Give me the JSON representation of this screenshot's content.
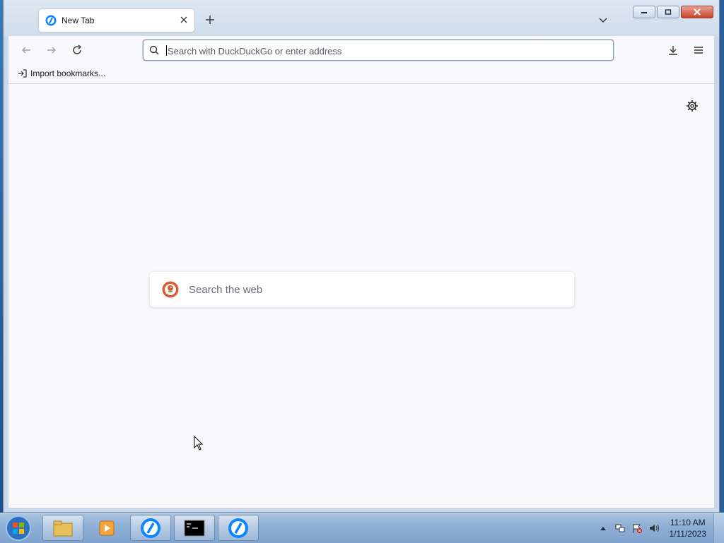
{
  "browser": {
    "tab": {
      "title": "New Tab"
    },
    "urlbar": {
      "placeholder": "Search with DuckDuckGo or enter address",
      "value": ""
    },
    "bookmarks_bar": {
      "import_label": "Import bookmarks..."
    },
    "new_tab": {
      "websearch_placeholder": "Search the web"
    }
  },
  "taskbar": {
    "items": [
      "file-explorer",
      "media-player",
      "firefox",
      "command-prompt",
      "firefox"
    ],
    "clock": {
      "time": "11:10 AM",
      "date": "1/11/2023"
    }
  },
  "colors": {
    "tab_bg": "#ffffff",
    "toolbar_bg": "#f9f9fb",
    "close_red": "#c9422a",
    "ddg_orange": "#de5833"
  }
}
